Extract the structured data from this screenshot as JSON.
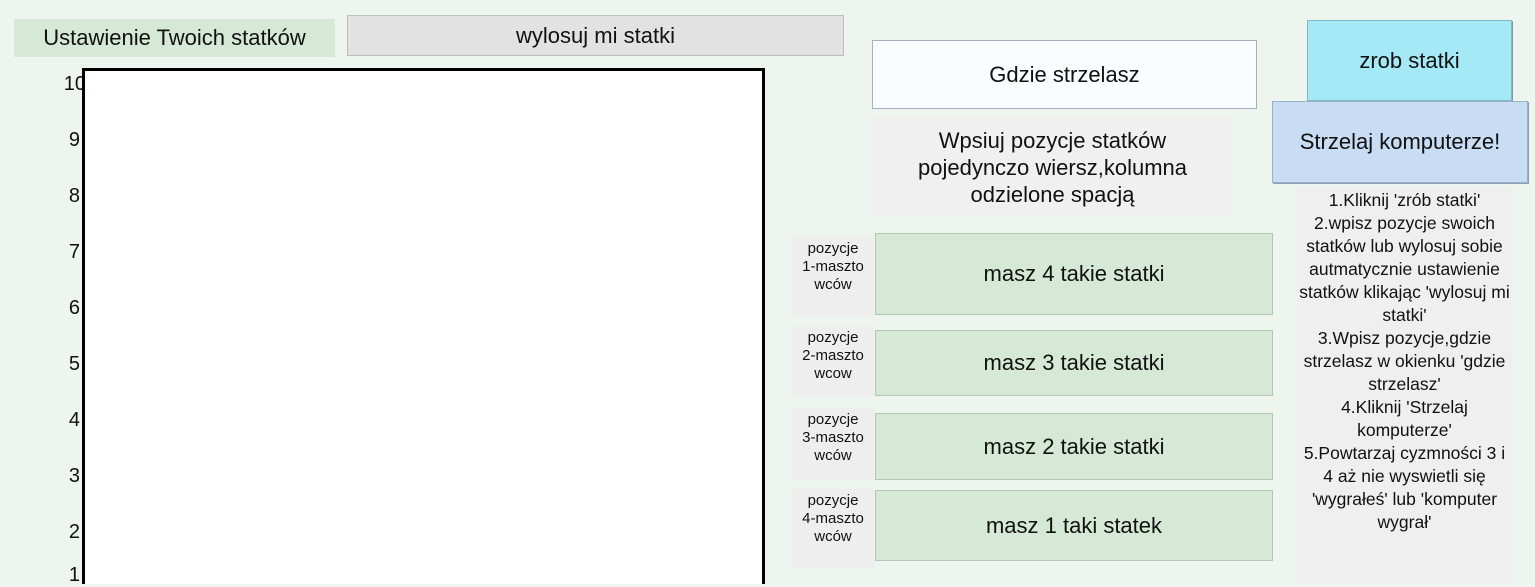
{
  "header": {
    "title": "Ustawienie Twoich statków",
    "random_button": "wylosuj mi statki"
  },
  "board": {
    "y_labels": [
      "10",
      "9",
      "8",
      "7",
      "6",
      "5",
      "4",
      "3",
      "2",
      "1"
    ]
  },
  "shoot": {
    "label": "Gdzie strzelasz"
  },
  "hint": "Wpsiuj pozycje statków pojedynczo wiersz,kolumna odzielone spacją",
  "buttons": {
    "make_ships": "zrob statki",
    "fire": "Strzelaj komputerze!"
  },
  "ships": [
    {
      "label": "pozycje\n1-maszto\nwców",
      "field": "masz 4 takie statki"
    },
    {
      "label": "pozycje\n2-maszto\nwcow",
      "field": "masz 3 takie statki"
    },
    {
      "label": "pozycje\n3-maszto\nwców",
      "field": "masz 2 takie statki"
    },
    {
      "label": "pozycje\n4-maszto\nwców",
      "field": "masz 1 taki statek"
    }
  ],
  "instructions": "1.Kliknij 'zrób statki'\n2.wpisz pozycje swoich statków lub wylosuj sobie autmatycznie ustawienie statków klikając 'wylosuj mi statki'\n3.Wpisz pozycje,gdzie strzelasz w okienku 'gdzie strzelasz'\n4.Kliknij 'Strzelaj komputerze'\n5.Powtarzaj cyzmności 3 i 4 aż nie wyswietli się 'wygrałeś' lub 'komputer wygrał'"
}
